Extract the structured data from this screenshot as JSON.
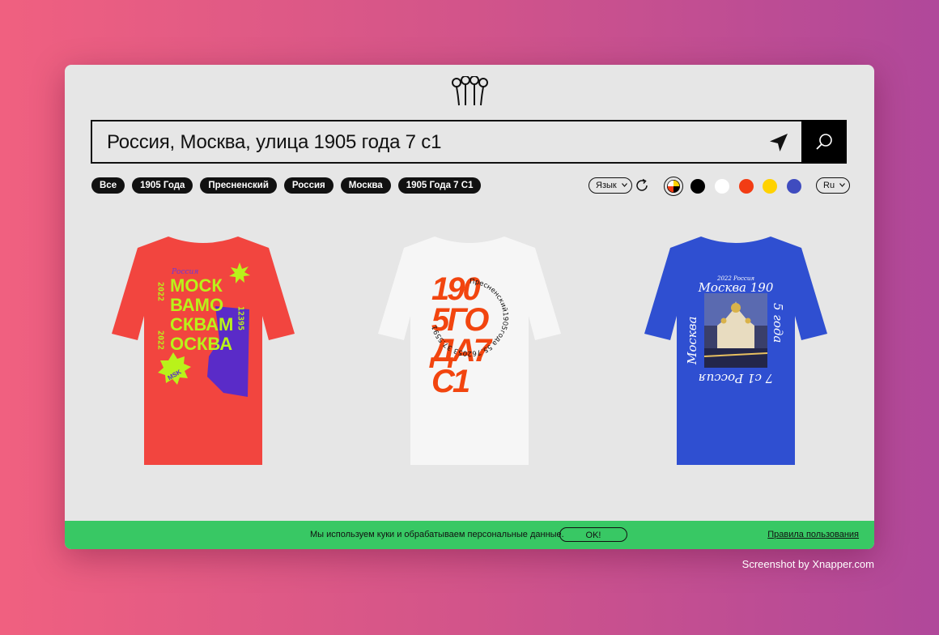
{
  "search": {
    "value": "Россия, Москва, улица 1905 года 7 с1"
  },
  "chips": [
    "Все",
    "1905 Года",
    "Пресненский",
    "Россия",
    "Москва",
    "1905 Года 7 С1"
  ],
  "toolbar": {
    "language_label": "Язык",
    "locale_label": "Ru"
  },
  "colors": [
    "#000000",
    "#ffffff",
    "#f23c14",
    "#ffd200",
    "#3f4cbf"
  ],
  "products": [
    {
      "shirt_color": "#f2453f",
      "design": {
        "tag": "Россия",
        "year": "2022",
        "code": "12395",
        "lines": [
          "МОСК",
          "ВАМО",
          "СКВАМ",
          "ОСКВА"
        ],
        "badge": "MSK"
      }
    },
    {
      "shirt_color": "#f6f6f6",
      "design": {
        "lines": [
          "190",
          "5ГО",
          "ДА7",
          "С1"
        ],
        "ring": "Пресненский1905года 55.762053 37.5591"
      }
    },
    {
      "shirt_color": "#2f4fd1",
      "design": {
        "top": "2022 Россия",
        "headline": "Москва 190",
        "side_left": "Москва",
        "side_right": "5 года",
        "bottom": "7 с1 Россия"
      }
    }
  ],
  "cookie": {
    "text": "Мы используем куки и обрабатываем персональные данные.",
    "ok_label": "OK!",
    "rules_label": "Правила пользования"
  },
  "watermark": "Screenshot by Xnapper.com"
}
